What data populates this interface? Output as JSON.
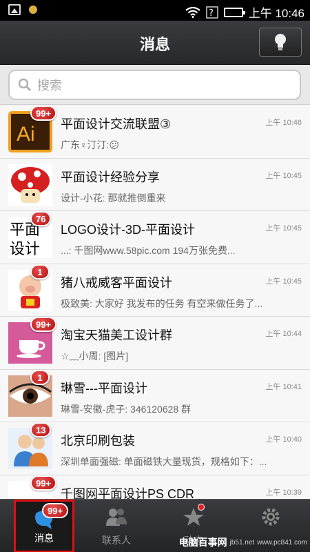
{
  "status_bar": {
    "time": "上午 10:46"
  },
  "header": {
    "title": "消息"
  },
  "search": {
    "placeholder": "搜索"
  },
  "messages": [
    {
      "name": "平面设计交流联盟③",
      "preview": "广东♀汀汀:😕",
      "time": "上午 10:46",
      "badge": "99+",
      "avatar": "ai-logo"
    },
    {
      "name": "平面设计经验分享",
      "preview": "设计-小花: 那就推倒重来",
      "time": "上午 10:45",
      "badge": "",
      "avatar": "mushroom"
    },
    {
      "name": "LOGO设计-3D-平面设计",
      "preview": "...: 千图网www.58pic.com 194万张免费...",
      "time": "上午 10:45",
      "badge": "76",
      "avatar": "pingmian-sheji-text"
    },
    {
      "name": "猪八戒威客平面设计",
      "preview": "极致美: 大家好 我发布的任务 有空来做任务了...",
      "time": "上午 10:45",
      "badge": "1",
      "avatar": "pig-cartoon"
    },
    {
      "name": "淘宝天猫美工设计群",
      "preview": "☆﹏小周: [图片]",
      "time": "上午 10:44",
      "badge": "99+",
      "avatar": "coffee-cup"
    },
    {
      "name": "琳雪---平面设计",
      "preview": "琳雪-安徽-虎子: 346120628 群",
      "time": "上午 10:41",
      "badge": "1",
      "avatar": "eye-photo"
    },
    {
      "name": "北京印刷包装",
      "preview": "深圳单面强磁: 单面磁铁大量现货，规格如下：...",
      "time": "上午 10:40",
      "badge": "13",
      "avatar": "people-icon"
    },
    {
      "name": "千图网平面设计PS CDR",
      "preview": "",
      "time": "上午 10:39",
      "badge": "99+",
      "avatar": "qiantu-logo"
    }
  ],
  "bottom_nav": [
    {
      "label": "消息",
      "badge": "99+",
      "active": true
    },
    {
      "label": "联系人"
    },
    {
      "label": "动态"
    },
    {
      "label": ""
    }
  ],
  "watermark": {
    "text": "电脑百事网",
    "sub": "www.pc841.com",
    "site": "jb51.net"
  }
}
